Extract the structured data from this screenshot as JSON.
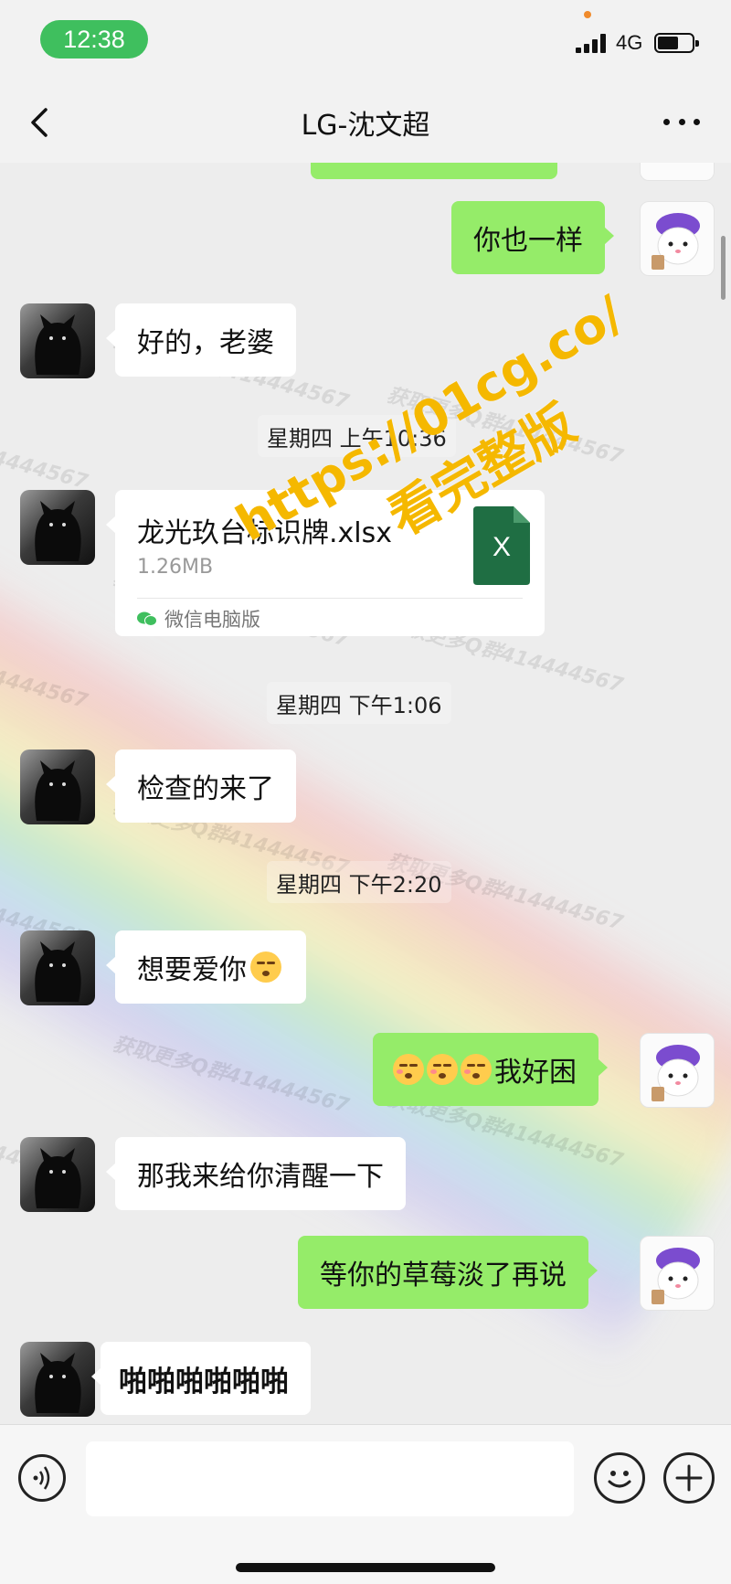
{
  "status_bar": {
    "time": "12:38",
    "network": "4G",
    "accent": "#3fbf5e"
  },
  "nav": {
    "title": "LG-沈文超",
    "back_icon": "chevron-left-icon",
    "more_icon": "more-dots-icon"
  },
  "messages": [
    {
      "side": "out",
      "text": "你也一样"
    },
    {
      "side": "in",
      "text": "好的，老婆"
    },
    {
      "side": "time",
      "text": "星期四 上午10:36"
    },
    {
      "side": "in",
      "type": "file",
      "file_name": "龙光玖台标识牌.xlsx",
      "file_size": "1.26MB",
      "file_source": "微信电脑版",
      "file_icon": "excel-file-icon",
      "file_badge": "X"
    },
    {
      "side": "time",
      "text": "星期四 下午1:06"
    },
    {
      "side": "in",
      "text": "检查的来了"
    },
    {
      "side": "time",
      "text": "星期四 下午2:20"
    },
    {
      "side": "in",
      "text": "想要爱你"
    },
    {
      "side": "out",
      "text": "我好困"
    },
    {
      "side": "in",
      "text": "那我来给你清醒一下"
    },
    {
      "side": "out",
      "text": "等你的草莓淡了再说"
    },
    {
      "side": "in",
      "text": "啪啪啪啪啪啪"
    }
  ],
  "overlay": {
    "promo_line1": "https://01cg.co/",
    "promo_line2": "看完整版",
    "watermark": "获取更多Q群414444567",
    "watermark_tail": "414444567",
    "promo_color": "#f5b800"
  },
  "input_bar": {
    "placeholder": "",
    "voice_icon": "voice-icon",
    "emoji_icon": "emoji-icon",
    "plus_icon": "plus-icon"
  },
  "colors": {
    "bubble_out": "#95ec69",
    "bubble_in": "#ffffff",
    "background": "#ededed"
  }
}
